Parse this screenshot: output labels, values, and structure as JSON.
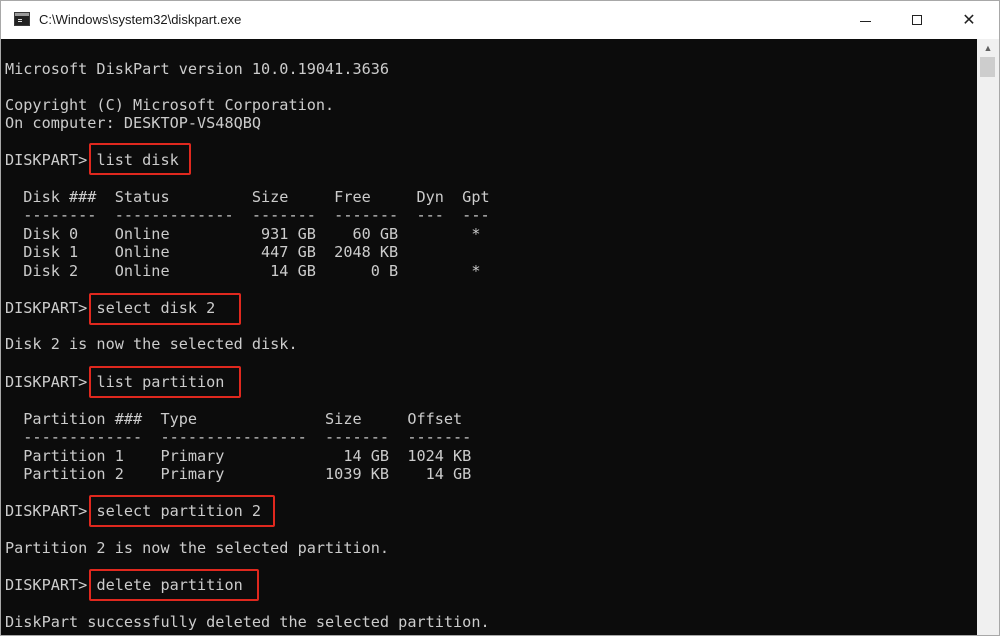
{
  "window": {
    "title": "C:\\Windows\\system32\\diskpart.exe",
    "minimize_glyph": "—",
    "maximize_glyph": "☐",
    "close_glyph": "✕"
  },
  "console": {
    "version": "Microsoft DiskPart version 10.0.19041.3636",
    "copyright": "Copyright (C) Microsoft Corporation.",
    "computer": "On computer: DESKTOP-VS48QBQ",
    "prompt": "DISKPART> ",
    "commands": {
      "list_disk": "list disk",
      "select_disk": "select disk 2",
      "list_partition": "list partition",
      "select_partition": "select partition 2",
      "delete_partition": "delete partition"
    },
    "disk_table": {
      "header": "  Disk ###  Status         Size     Free     Dyn  Gpt",
      "divider": "  --------  -------------  -------  -------  ---  ---",
      "rows": [
        "  Disk 0    Online          931 GB    60 GB        *",
        "  Disk 1    Online          447 GB  2048 KB",
        "  Disk 2    Online           14 GB      0 B        *"
      ]
    },
    "select_disk_result": "Disk 2 is now the selected disk.",
    "partition_table": {
      "header": "  Partition ###  Type              Size     Offset",
      "divider": "  -------------  ----------------  -------  -------",
      "rows": [
        "  Partition 1    Primary             14 GB  1024 KB",
        "  Partition 2    Primary           1039 KB    14 GB"
      ]
    },
    "select_partition_result": "Partition 2 is now the selected partition.",
    "delete_result": "DiskPart successfully deleted the selected partition."
  },
  "colors": {
    "console_background": "#0c0c0c",
    "console_text": "#cccccc",
    "highlight_box": "#e0281e"
  }
}
